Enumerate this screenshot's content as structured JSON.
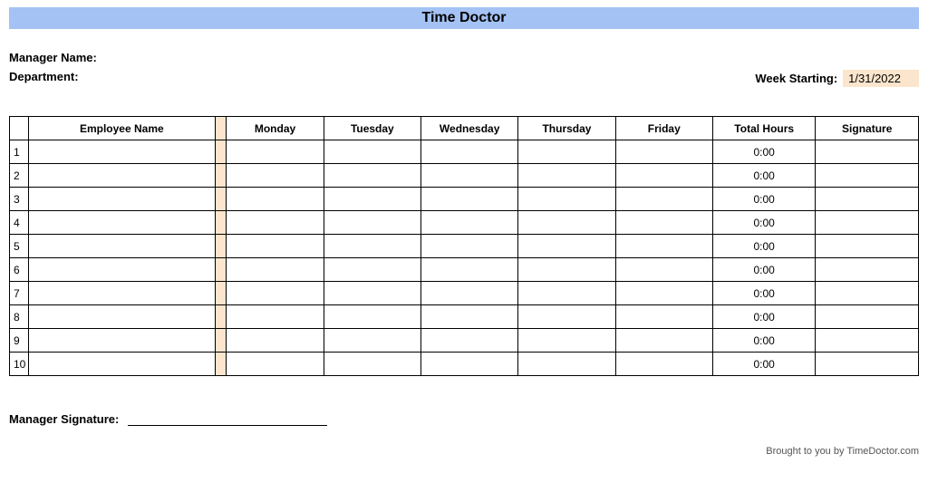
{
  "title": "Time Doctor",
  "labels": {
    "manager_name": "Manager Name:",
    "department": "Department:",
    "week_starting": "Week Starting:",
    "manager_signature": "Manager Signature:"
  },
  "week_starting_value": "1/31/2022",
  "columns": {
    "index": "",
    "employee": "Employee Name",
    "monday": "Monday",
    "tuesday": "Tuesday",
    "wednesday": "Wednesday",
    "thursday": "Thursday",
    "friday": "Friday",
    "total_hours": "Total Hours",
    "signature": "Signature"
  },
  "rows": [
    {
      "index": "1",
      "employee": "",
      "mon": "",
      "tue": "",
      "wed": "",
      "thu": "",
      "fri": "",
      "total": "0:00",
      "sig": ""
    },
    {
      "index": "2",
      "employee": "",
      "mon": "",
      "tue": "",
      "wed": "",
      "thu": "",
      "fri": "",
      "total": "0:00",
      "sig": ""
    },
    {
      "index": "3",
      "employee": "",
      "mon": "",
      "tue": "",
      "wed": "",
      "thu": "",
      "fri": "",
      "total": "0:00",
      "sig": ""
    },
    {
      "index": "4",
      "employee": "",
      "mon": "",
      "tue": "",
      "wed": "",
      "thu": "",
      "fri": "",
      "total": "0:00",
      "sig": ""
    },
    {
      "index": "5",
      "employee": "",
      "mon": "",
      "tue": "",
      "wed": "",
      "thu": "",
      "fri": "",
      "total": "0:00",
      "sig": ""
    },
    {
      "index": "6",
      "employee": "",
      "mon": "",
      "tue": "",
      "wed": "",
      "thu": "",
      "fri": "",
      "total": "0:00",
      "sig": ""
    },
    {
      "index": "7",
      "employee": "",
      "mon": "",
      "tue": "",
      "wed": "",
      "thu": "",
      "fri": "",
      "total": "0:00",
      "sig": ""
    },
    {
      "index": "8",
      "employee": "",
      "mon": "",
      "tue": "",
      "wed": "",
      "thu": "",
      "fri": "",
      "total": "0:00",
      "sig": ""
    },
    {
      "index": "9",
      "employee": "",
      "mon": "",
      "tue": "",
      "wed": "",
      "thu": "",
      "fri": "",
      "total": "0:00",
      "sig": ""
    },
    {
      "index": "10",
      "employee": "",
      "mon": "",
      "tue": "",
      "wed": "",
      "thu": "",
      "fri": "",
      "total": "0:00",
      "sig": ""
    }
  ],
  "footer": "Brought to you by TimeDoctor.com"
}
